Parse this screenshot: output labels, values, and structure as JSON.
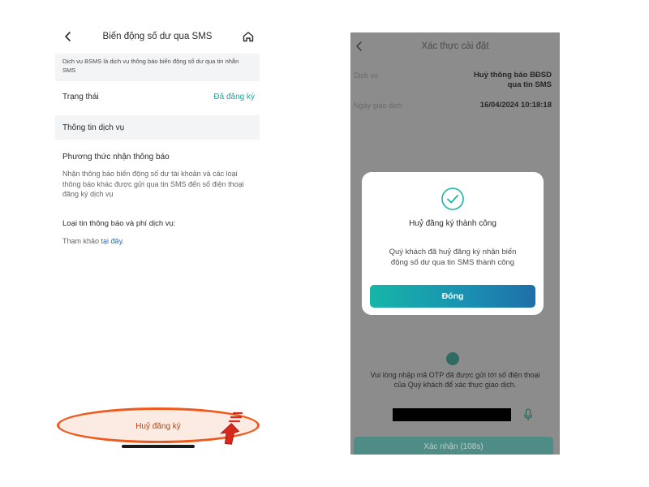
{
  "left_screen": {
    "header": {
      "title": "Biến động số dư qua SMS",
      "back_icon": "chevron-left-icon",
      "home_icon": "home-icon"
    },
    "description": "Dịch vụ BSMS là dịch vụ thông báo biến động số dư qua tin nhắn SMS",
    "status": {
      "label": "Trạng thái",
      "value": "Đã đăng ký",
      "value_color": "#19a99a"
    },
    "service_info": {
      "label": "Thông tin dịch vụ"
    },
    "notification_method": {
      "title": "Phương thức nhận thông báo",
      "body": "Nhận thông báo biến động số dư tài khoản và các loại thông báo khác được gửi qua tin SMS đến số điện thoại đăng ký dịch vụ"
    },
    "message_types": {
      "title": "Loại tin thông báo và phí dịch vụ:",
      "prefix": "Tham khảo",
      "link": "tại đây",
      "suffix": "."
    },
    "cancel_button": {
      "label": "Huỷ đăng ký",
      "highlight_color": "#ef5a1c"
    },
    "annotation": {
      "arrow_icon": "pointing-arrow-icon"
    }
  },
  "right_screen": {
    "header": {
      "title": "Xác thực cài đặt",
      "back_icon": "chevron-left-icon"
    },
    "service_row": {
      "label": "Dịch vụ",
      "value_line1": "Huỷ thông báo BĐSD",
      "value_line2": "qua tin SMS"
    },
    "date_row": {
      "label": "Ngày giao dịch",
      "value": "16/04/2024 10:18:18"
    },
    "otp": {
      "line1": "Vui lòng nhập mã OTP đã được gửi tới số điện thoại",
      "line2": "của Quý khách để xác thực giao dịch.",
      "mic_icon": "microphone-icon"
    },
    "confirm_button": {
      "label": "Xác nhận (108s)"
    },
    "modal": {
      "icon": "check-circle-icon",
      "title": "Huỷ đăng ký thành công",
      "body_line1": "Quý khách đã huỷ đăng ký nhận biến",
      "body_line2": "động số dư qua tin SMS thành công",
      "button_label": "Đóng",
      "accent_color": "#17b5a8"
    }
  }
}
